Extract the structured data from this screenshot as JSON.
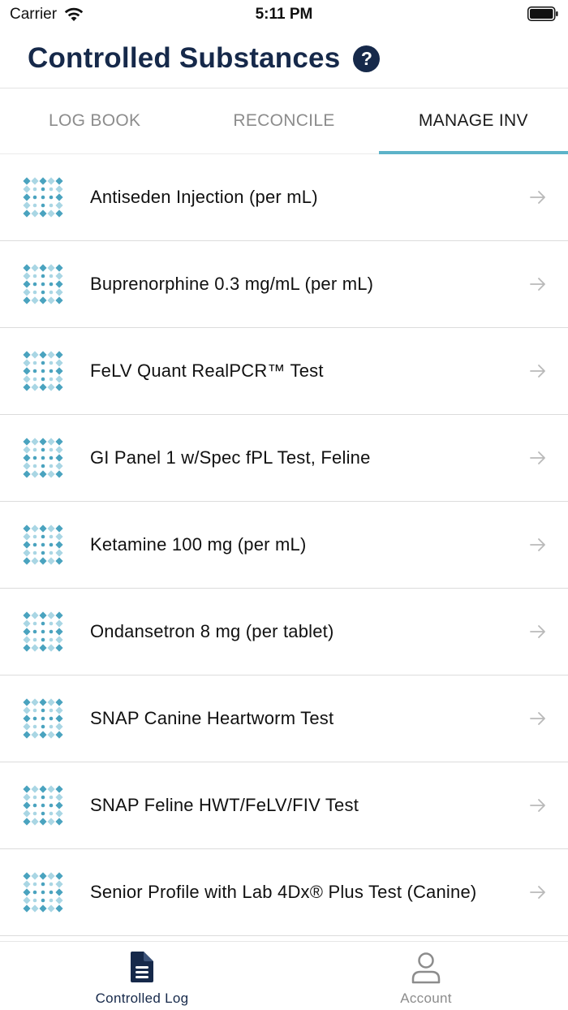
{
  "status_bar": {
    "carrier": "Carrier",
    "time": "5:11 PM"
  },
  "header": {
    "title": "Controlled Substances",
    "help_symbol": "?",
    "title_color": "#16294a"
  },
  "tabs": [
    {
      "label": "LOG BOOK",
      "active": false
    },
    {
      "label": "RECONCILE",
      "active": false
    },
    {
      "label": "MANAGE INV",
      "active": true
    }
  ],
  "accent_color": "#5db3c9",
  "items": [
    {
      "label": "Antiseden Injection (per mL)",
      "icon": "product-grid-icon"
    },
    {
      "label": "Buprenorphine 0.3 mg/mL (per mL)",
      "icon": "product-grid-icon"
    },
    {
      "label": "FeLV Quant RealPCR™ Test",
      "icon": "product-grid-icon"
    },
    {
      "label": "GI Panel 1 w/Spec fPL Test, Feline",
      "icon": "product-grid-icon"
    },
    {
      "label": "Ketamine 100 mg (per mL)",
      "icon": "product-grid-icon"
    },
    {
      "label": "Ondansetron 8 mg (per tablet)",
      "icon": "product-grid-icon"
    },
    {
      "label": "SNAP Canine Heartworm Test",
      "icon": "product-grid-icon"
    },
    {
      "label": "SNAP Feline HWT/FeLV/FIV Test",
      "icon": "product-grid-icon"
    },
    {
      "label": "Senior Profile with Lab 4Dx® Plus Test (Canine)",
      "icon": "product-grid-icon"
    }
  ],
  "bottom_nav": [
    {
      "label": "Controlled Log",
      "icon": "document-icon",
      "active": true
    },
    {
      "label": "Account",
      "icon": "person-icon",
      "active": false
    }
  ]
}
